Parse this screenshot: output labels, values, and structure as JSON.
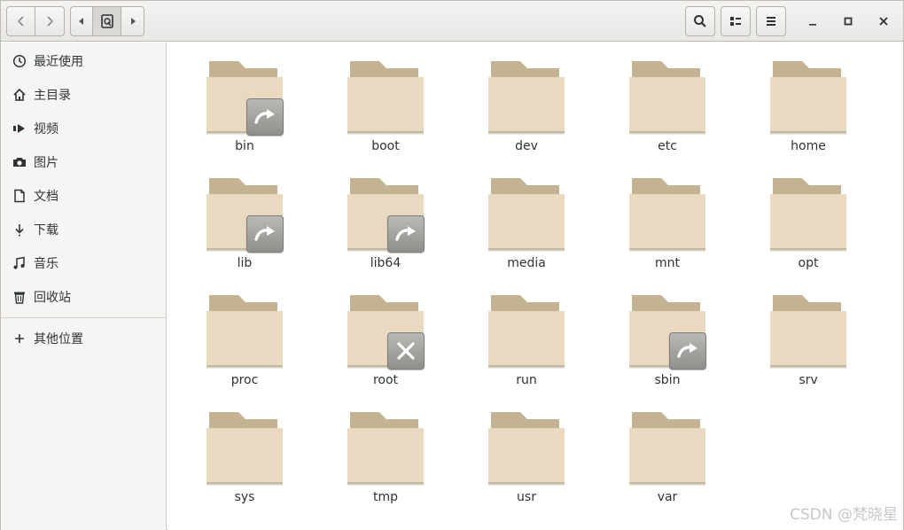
{
  "window": {
    "title": "/"
  },
  "header": {
    "back_button": "back",
    "forward_button": "forward",
    "path_buttons": [
      "root"
    ]
  },
  "sidebar": {
    "items": [
      {
        "label": "最近使用",
        "icon": "clock-icon"
      },
      {
        "label": "主目录",
        "icon": "home-icon"
      },
      {
        "label": "视频",
        "icon": "video-icon"
      },
      {
        "label": "图片",
        "icon": "camera-icon"
      },
      {
        "label": "文档",
        "icon": "document-icon"
      },
      {
        "label": "下载",
        "icon": "download-icon"
      },
      {
        "label": "音乐",
        "icon": "music-icon"
      },
      {
        "label": "回收站",
        "icon": "trash-icon"
      }
    ],
    "other_locations": {
      "label": "其他位置",
      "icon": "plus-icon"
    }
  },
  "files": [
    {
      "name": "bin",
      "emblem": "symlink"
    },
    {
      "name": "boot",
      "emblem": ""
    },
    {
      "name": "dev",
      "emblem": ""
    },
    {
      "name": "etc",
      "emblem": ""
    },
    {
      "name": "home",
      "emblem": ""
    },
    {
      "name": "lib",
      "emblem": "symlink"
    },
    {
      "name": "lib64",
      "emblem": "symlink"
    },
    {
      "name": "media",
      "emblem": ""
    },
    {
      "name": "mnt",
      "emblem": ""
    },
    {
      "name": "opt",
      "emblem": ""
    },
    {
      "name": "proc",
      "emblem": ""
    },
    {
      "name": "root",
      "emblem": "unreadable"
    },
    {
      "name": "run",
      "emblem": ""
    },
    {
      "name": "sbin",
      "emblem": "symlink"
    },
    {
      "name": "srv",
      "emblem": ""
    },
    {
      "name": "sys",
      "emblem": ""
    },
    {
      "name": "tmp",
      "emblem": ""
    },
    {
      "name": "usr",
      "emblem": ""
    },
    {
      "name": "var",
      "emblem": ""
    }
  ],
  "watermark": "CSDN @梵晓星",
  "colors": {
    "folder_body": "#e8d9c0",
    "folder_tab": "#c4b393",
    "emblem": "#a3a3a0"
  }
}
